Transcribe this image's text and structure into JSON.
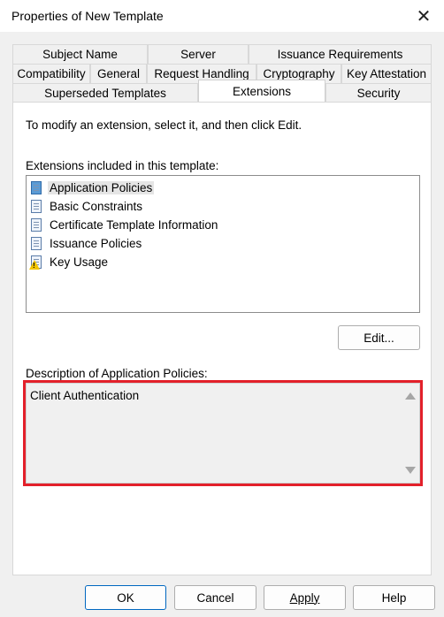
{
  "window": {
    "title": "Properties of New Template"
  },
  "tabs": {
    "row1": [
      "Subject Name",
      "Server",
      "Issuance Requirements"
    ],
    "row2": [
      "Compatibility",
      "General",
      "Request Handling",
      "Cryptography",
      "Key Attestation"
    ],
    "row3": [
      "Superseded Templates",
      "Extensions",
      "Security"
    ],
    "active": "Extensions"
  },
  "panel": {
    "intro": "To modify an extension, select it, and then click Edit.",
    "extensions_label": "Extensions included in this template:",
    "extensions": [
      {
        "label": "Application Policies",
        "icon": "document-selected-icon",
        "selected": true
      },
      {
        "label": "Basic Constraints",
        "icon": "document-icon"
      },
      {
        "label": "Certificate Template Information",
        "icon": "document-icon"
      },
      {
        "label": "Issuance Policies",
        "icon": "document-icon"
      },
      {
        "label": "Key Usage",
        "icon": "document-warning-icon"
      }
    ],
    "edit_button": "Edit...",
    "description_label": "Description of Application Policies:",
    "description": "Client Authentication",
    "highlight_color": "#e3202a"
  },
  "buttons": {
    "ok": "OK",
    "cancel": "Cancel",
    "apply": "Apply",
    "help": "Help"
  }
}
